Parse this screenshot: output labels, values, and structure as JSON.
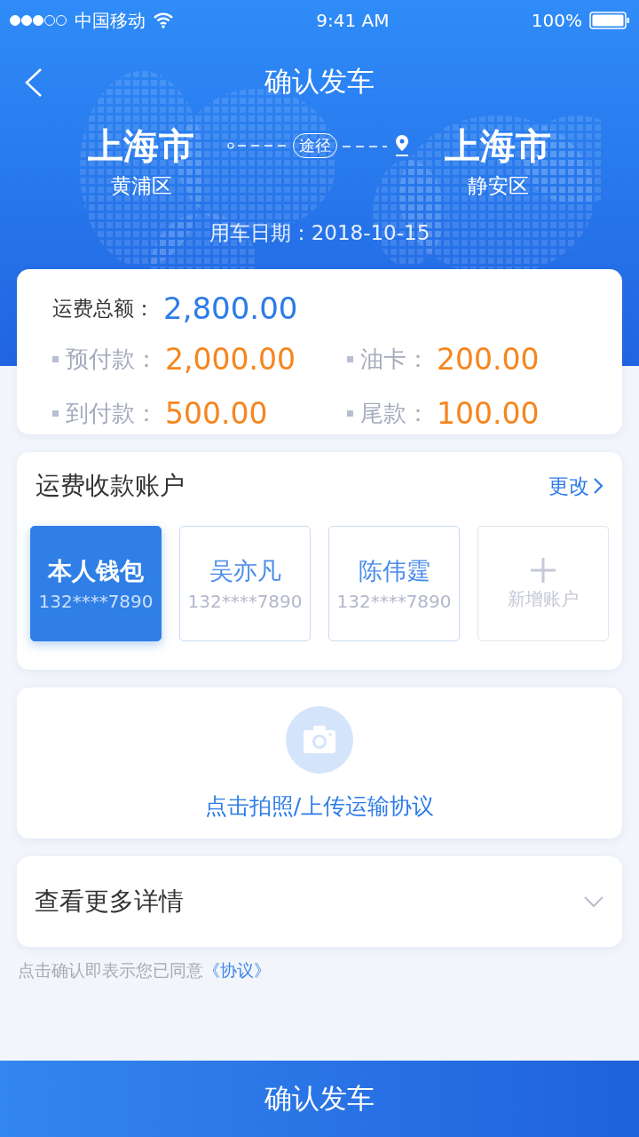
{
  "status_bar": {
    "carrier": "中国移动",
    "time": "9:41 AM",
    "battery": "100%"
  },
  "header": {
    "title": "确认发车",
    "origin": {
      "city": "上海市",
      "district": "黄浦区"
    },
    "via": "途径",
    "destination": {
      "city": "上海市",
      "district": "静安区"
    },
    "date": "用车日期：2018-10-15"
  },
  "fees": {
    "total": {
      "label": "运费总额：",
      "value": "2,800.00"
    },
    "items": [
      {
        "label": "预付款：",
        "value": "2,000.00"
      },
      {
        "label": "油卡：",
        "value": "200.00"
      },
      {
        "label": "到付款：",
        "value": "500.00"
      },
      {
        "label": "尾款：",
        "value": "100.00"
      }
    ]
  },
  "accounts": {
    "title": "运费收款账户",
    "action": "更改",
    "items": [
      {
        "kind": "account",
        "name": "本人钱包",
        "phone": "132****7890",
        "selected": true
      },
      {
        "kind": "account",
        "name": "吴亦凡",
        "phone": "132****7890",
        "selected": false
      },
      {
        "kind": "account",
        "name": "陈伟霆",
        "phone": "132****7890",
        "selected": false
      },
      {
        "kind": "add",
        "label": "新增账户"
      }
    ]
  },
  "upload": {
    "label": "点击拍照/上传运输协议"
  },
  "details": {
    "label": "查看更多详情",
    "expanded": false
  },
  "agreement": {
    "text": "点击确认即表示您已同意",
    "link": "《协议》"
  },
  "confirm_button": "确认发车"
}
